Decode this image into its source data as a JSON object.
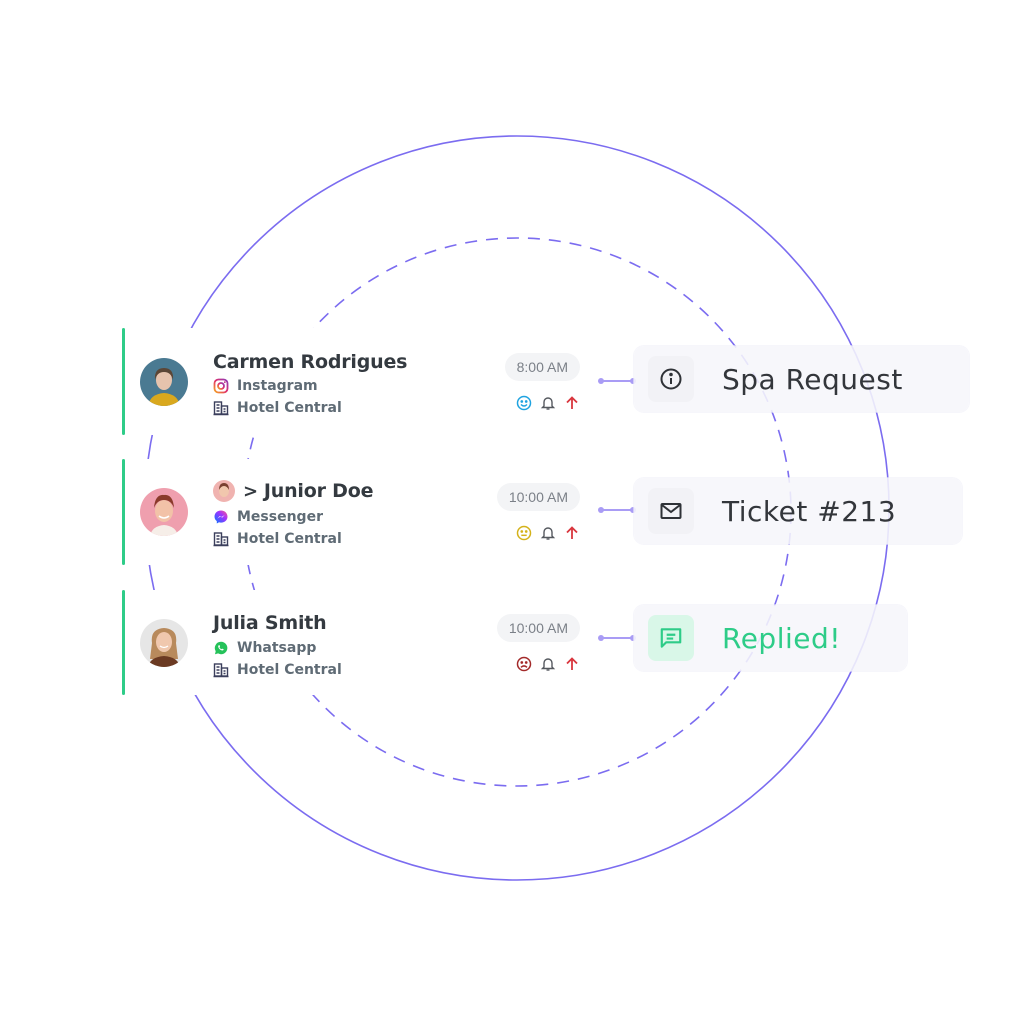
{
  "colors": {
    "ring": "#7b6cf0",
    "accent": "#2ecc88",
    "connector": "#a99cf5",
    "alert_arrow": "#d9363e"
  },
  "conversations": [
    {
      "name": "Carmen Rodrigues",
      "forwarded": false,
      "channel": "Instagram",
      "channel_icon": "instagram-icon",
      "property": "Hotel Central",
      "property_icon": "building-icon",
      "time": "8:00 AM",
      "sentiment": "happy",
      "sentiment_color": "#1fa3e0",
      "action": {
        "icon": "info-icon",
        "label": "Spa Request",
        "state": "default"
      }
    },
    {
      "name": "Junior Doe",
      "forwarded": true,
      "channel": "Messenger",
      "channel_icon": "messenger-icon",
      "property": "Hotel Central",
      "property_icon": "building-icon",
      "time": "10:00 AM",
      "sentiment": "neutral",
      "sentiment_color": "#d4b21a",
      "action": {
        "icon": "mail-icon",
        "label": "Ticket #213",
        "state": "default"
      }
    },
    {
      "name": "Julia Smith",
      "forwarded": false,
      "channel": "Whatsapp",
      "channel_icon": "whatsapp-icon",
      "property": "Hotel Central",
      "property_icon": "building-icon",
      "time": "10:00 AM",
      "sentiment": "sad",
      "sentiment_color": "#a32a2a",
      "action": {
        "icon": "chat-icon",
        "label": "Replied!",
        "state": "replied"
      }
    }
  ],
  "chevron": ">"
}
